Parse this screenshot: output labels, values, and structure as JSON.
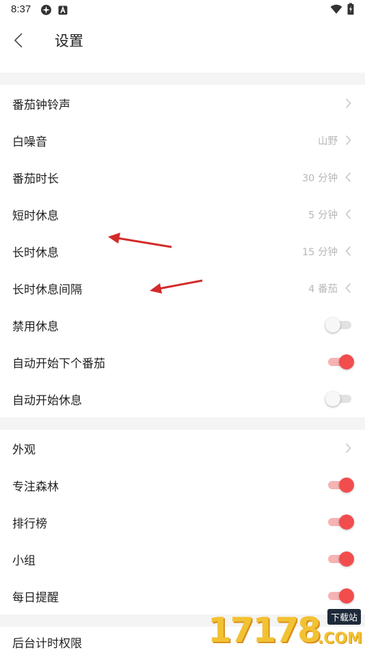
{
  "status_bar": {
    "time": "8:37"
  },
  "header": {
    "title": "设置"
  },
  "section1": {
    "rows": [
      {
        "label": "番茄钟铃声",
        "value": "",
        "chevron": "chevron-right-icon"
      },
      {
        "label": "白噪音",
        "value": "山野",
        "chevron": "chevron-right-icon"
      },
      {
        "label": "番茄时长",
        "value": "30 分钟",
        "chevron": "chevron-left-icon"
      },
      {
        "label": "短时休息",
        "value": "5 分钟",
        "chevron": "chevron-left-icon"
      },
      {
        "label": "长时休息",
        "value": "15 分钟",
        "chevron": "chevron-left-icon"
      },
      {
        "label": "长时休息间隔",
        "value": "4 番茄",
        "chevron": "chevron-left-icon"
      },
      {
        "label": "禁用休息",
        "toggle": false
      },
      {
        "label": "自动开始下个番茄",
        "toggle": true
      },
      {
        "label": "自动开始休息",
        "toggle": false
      }
    ]
  },
  "section2": {
    "rows": [
      {
        "label": "外观",
        "value": "",
        "chevron": "chevron-right-icon"
      },
      {
        "label": "专注森林",
        "toggle": true
      },
      {
        "label": "排行榜",
        "toggle": true
      },
      {
        "label": "小组",
        "toggle": true
      },
      {
        "label": "每日提醒",
        "toggle": true
      }
    ]
  },
  "section3": {
    "rows": [
      {
        "label": "后台计时权限"
      }
    ]
  },
  "watermark": {
    "digits": "17178",
    "badge": "下载站",
    "domain": ".COM"
  },
  "colors": {
    "accent": "#f24d4d",
    "accent_track": "#f6b3b3",
    "value_text": "#b8b8b8",
    "separator": "#f4f4f5",
    "annotation_arrow": "#d42a2a"
  }
}
